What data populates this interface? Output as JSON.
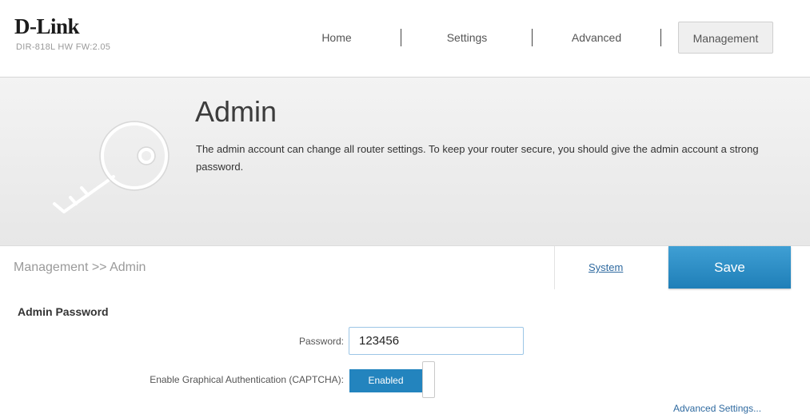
{
  "header": {
    "brand": "D-Link",
    "model_info": "DIR-818L  HW   FW:2.05",
    "nav": [
      {
        "label": "Home"
      },
      {
        "label": "Settings"
      },
      {
        "label": "Advanced"
      },
      {
        "label": "Management"
      }
    ]
  },
  "banner": {
    "icon": "key-icon",
    "title": "Admin",
    "description": "The admin account can change all router settings. To keep your router secure, you should give the admin account a strong password."
  },
  "crumbbar": {
    "breadcrumb": "Management >> Admin",
    "system_link": "System",
    "save_label": "Save"
  },
  "form": {
    "section_title": "Admin Password",
    "password_label": "Password:",
    "password_value": "123456",
    "captcha_label": "Enable Graphical Authentication (CAPTCHA):",
    "captcha_state": "Enabled",
    "advanced_link": "Advanced Settings..."
  },
  "colors": {
    "accent": "#2384be",
    "link": "#2f6aa0"
  }
}
